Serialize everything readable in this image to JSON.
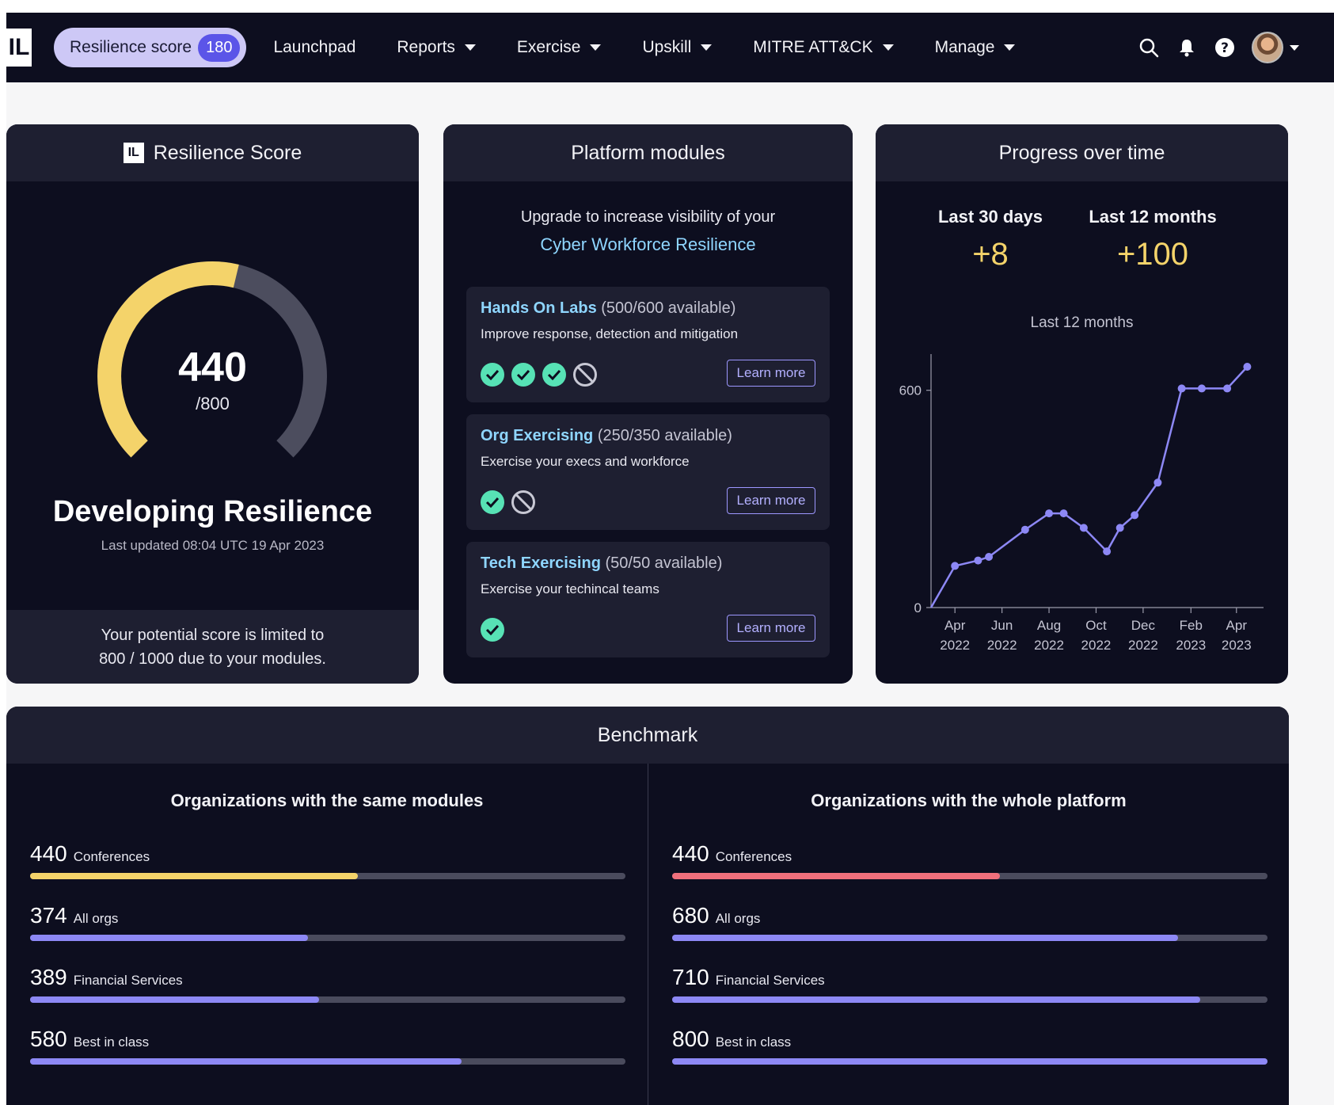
{
  "nav": {
    "logo": "IL",
    "score_label": "Resilience score",
    "score_value": "180",
    "items": [
      {
        "label": "Launchpad",
        "dropdown": false
      },
      {
        "label": "Reports",
        "dropdown": true
      },
      {
        "label": "Exercise",
        "dropdown": true
      },
      {
        "label": "Upskill",
        "dropdown": true
      },
      {
        "label": "MITRE ATT&CK",
        "dropdown": true
      },
      {
        "label": "Manage",
        "dropdown": true
      }
    ],
    "icons": [
      "search-icon",
      "bell-icon",
      "help-icon",
      "avatar"
    ]
  },
  "resilience": {
    "title": "Resilience Score",
    "score": "440",
    "max": "/800",
    "gauge": {
      "score": 440,
      "limit": 800,
      "total": 1000
    },
    "level": "Developing Resilience",
    "updated": "Last updated 08:04 UTC 19 Apr 2023",
    "footer_line1": "Your potential score is limited to",
    "footer_line2": "800 / 1000 due to your modules."
  },
  "modules": {
    "title": "Platform modules",
    "intro": "Upgrade to increase visibility of your",
    "intro_accent": "Cyber Workforce Resilience",
    "items": [
      {
        "name": "Hands On Labs",
        "availability": "(500/600 available)",
        "desc": "Improve response, detection and mitigation",
        "status": [
          "check",
          "check",
          "check",
          "ban"
        ],
        "cta": "Learn more"
      },
      {
        "name": "Org Exercising",
        "availability": "(250/350 available)",
        "desc": "Exercise your execs and workforce",
        "status": [
          "check",
          "ban"
        ],
        "cta": "Learn more"
      },
      {
        "name": "Tech Exercising",
        "availability": "(50/50 available)",
        "desc": "Exercise your techincal teams",
        "status": [
          "check"
        ],
        "cta": "Learn more"
      }
    ]
  },
  "progress": {
    "title": "Progress over time",
    "stat1_label": "Last 30 days",
    "stat1_value": "+8",
    "stat2_label": "Last 12 months",
    "stat2_value": "+100",
    "chart_title": "Last 12 months"
  },
  "chart_data": {
    "type": "line",
    "title": "Last 12 months",
    "xlabel": "",
    "ylabel": "",
    "x": [
      "2022-03-01",
      "2022-04-01",
      "2022-05-01",
      "2022-05-15",
      "2022-07-01",
      "2022-08-01",
      "2022-08-20",
      "2022-09-15",
      "2022-10-15",
      "2022-11-01",
      "2022-11-20",
      "2022-12-20",
      "2023-01-20",
      "2023-02-15",
      "2023-03-20",
      "2023-04-15"
    ],
    "y": [
      0,
      115,
      130,
      140,
      215,
      260,
      260,
      220,
      155,
      220,
      255,
      345,
      605,
      605,
      665,
      null
    ],
    "yticks": [
      0,
      600
    ],
    "ylim": [
      0,
      700
    ],
    "xticks": [
      "Apr 2022",
      "Jun 2022",
      "Aug 2022",
      "Oct 2022",
      "Dec 2022",
      "Feb 2023",
      "Apr 2023"
    ],
    "color": "#8d88f5"
  },
  "benchmark": {
    "title": "Benchmark",
    "left": {
      "title": "Organizations with the same modules",
      "rows": [
        {
          "value": "440",
          "label": "Conferences",
          "fraction": 0.55,
          "color": "#f4d36a"
        },
        {
          "value": "374",
          "label": "All orgs",
          "fraction": 0.467,
          "color": "#8d88f5"
        },
        {
          "value": "389",
          "label": "Financial Services",
          "fraction": 0.486,
          "color": "#8d88f5"
        },
        {
          "value": "580",
          "label": "Best in class",
          "fraction": 0.725,
          "color": "#8d88f5"
        }
      ]
    },
    "right": {
      "title": "Organizations with the whole platform",
      "rows": [
        {
          "value": "440",
          "label": "Conferences",
          "fraction": 0.55,
          "color": "#f0707c"
        },
        {
          "value": "680",
          "label": "All orgs",
          "fraction": 0.85,
          "color": "#8d88f5"
        },
        {
          "value": "710",
          "label": "Financial Services",
          "fraction": 0.8875,
          "color": "#8d88f5"
        },
        {
          "value": "800",
          "label": "Best in class",
          "fraction": 1.0,
          "color": "#8d88f5"
        }
      ]
    }
  },
  "colors": {
    "accent": "#5b55e8",
    "score_yellow": "#f4d36a",
    "cyan": "#8fd6ff",
    "check_green": "#57e2b5",
    "bar_purple": "#8d88f5"
  }
}
